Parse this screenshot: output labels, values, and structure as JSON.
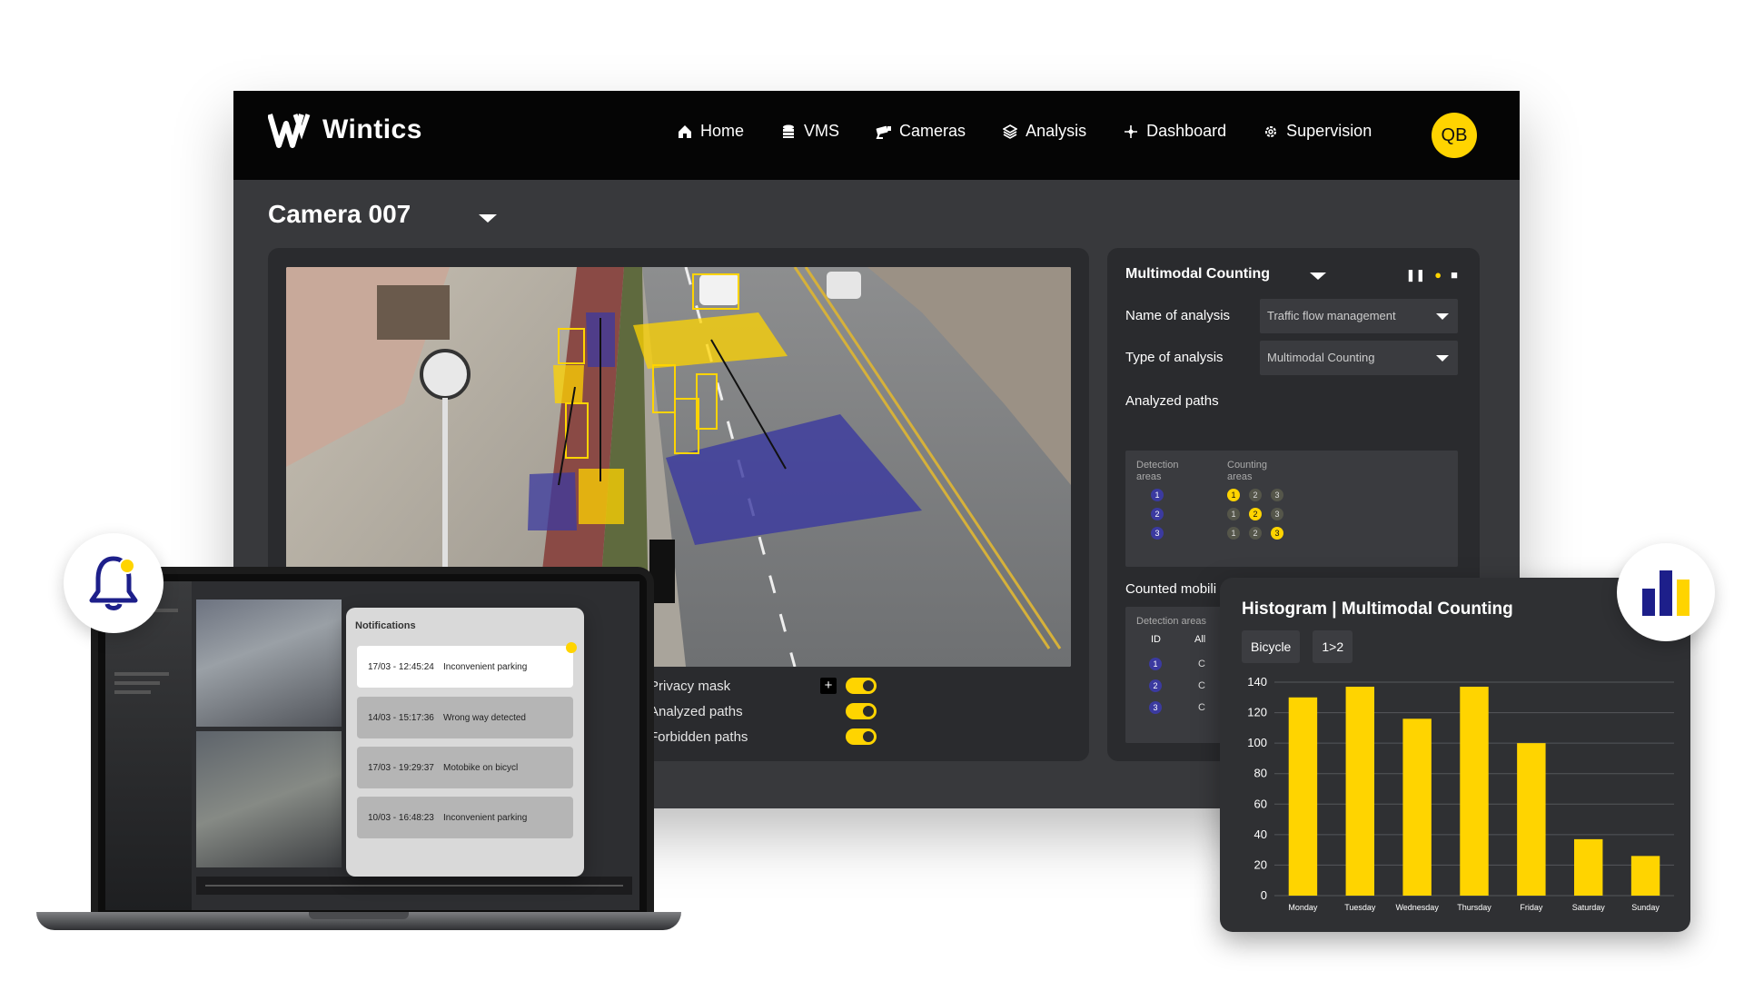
{
  "app": {
    "brand": "Wintics",
    "avatar_initials": "QB"
  },
  "nav": [
    {
      "label": "Home",
      "icon": "home-icon"
    },
    {
      "label": "VMS",
      "icon": "database-icon"
    },
    {
      "label": "Cameras",
      "icon": "camera-icon"
    },
    {
      "label": "Analysis",
      "icon": "layers-icon"
    },
    {
      "label": "Dashboard",
      "icon": "dashboard-icon"
    },
    {
      "label": "Supervision",
      "icon": "gear-icon"
    }
  ],
  "camera": {
    "title": "Camera 007"
  },
  "overlays": [
    {
      "label": "Privacy mask",
      "enabled": true,
      "has_add": true
    },
    {
      "label": "Analyzed paths",
      "enabled": true
    },
    {
      "label": "Forbidden paths",
      "enabled": true
    }
  ],
  "analysis_panel": {
    "title": "Multimodal Counting",
    "name_label": "Name of analysis",
    "name_value": "Traffic flow management",
    "type_label": "Type of analysis",
    "type_value": "Multimodal Counting",
    "paths_label": "Analyzed paths",
    "detection_header": "Detection areas",
    "counting_header": "Counting areas",
    "detection_ids": [
      "1",
      "2",
      "3"
    ],
    "counting_rows": [
      [
        "1",
        "2",
        "3"
      ],
      [
        "1",
        "2",
        "3"
      ],
      [
        "1",
        "2",
        "3"
      ]
    ],
    "counted_label": "Counted mobili",
    "mob_header": "Detection areas",
    "mob_cols": [
      "ID",
      "All"
    ],
    "mob_ids": [
      "1",
      "2",
      "3"
    ],
    "mob_vals": [
      "C",
      "C",
      "C"
    ]
  },
  "notifications": {
    "title": "Notifications",
    "items": [
      {
        "time": "17/03 - 12:45:24",
        "message": "Inconvenient parking",
        "active": true
      },
      {
        "time": "14/03 - 15:17:36",
        "message": "Wrong way detected",
        "active": false
      },
      {
        "time": "17/03 - 19:29:37",
        "message": "Motobike on bicycl",
        "active": false
      },
      {
        "time": "10/03 - 16:48:23",
        "message": "Inconvenient parking",
        "active": false
      }
    ]
  },
  "histogram": {
    "title": "Histogram |  Multimodal Counting",
    "tabs": [
      "Bicycle",
      "1>2"
    ]
  },
  "colors": {
    "accent": "#ffd400",
    "zone_blue": "#3b3aa0",
    "panel": "#2a2b2e"
  },
  "chart_data": {
    "type": "bar",
    "title": "Histogram |  Multimodal Counting",
    "categories": [
      "Monday",
      "Tuesday",
      "Wednesday",
      "Thursday",
      "Friday",
      "Saturday",
      "Sunday"
    ],
    "values": [
      130,
      137,
      116,
      137,
      100,
      37,
      26
    ],
    "yticks": [
      0,
      20,
      40,
      60,
      80,
      100,
      120,
      140
    ],
    "ylim": [
      0,
      140
    ],
    "xlabel": "",
    "ylabel": "",
    "grid": true,
    "bar_color": "#ffd400"
  }
}
